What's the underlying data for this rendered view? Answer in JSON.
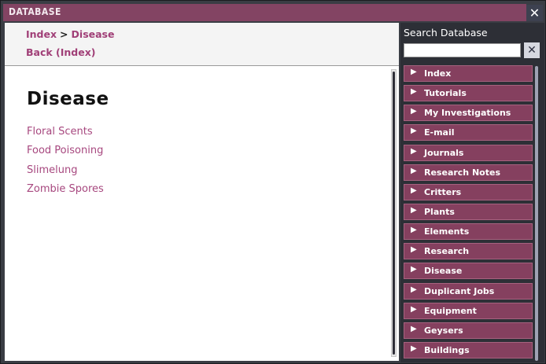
{
  "window": {
    "title": "DATABASE",
    "close_icon": "close-icon"
  },
  "breadcrumb": {
    "items": [
      "Index",
      "Disease"
    ],
    "separator": ">"
  },
  "back_link": "Back (Index)",
  "page": {
    "title": "Disease",
    "entries": [
      "Floral Scents",
      "Food Poisoning",
      "Slimelung",
      "Zombie Spores"
    ]
  },
  "search": {
    "label": "Search Database",
    "value": "",
    "placeholder": "",
    "clear_icon": "close-icon"
  },
  "categories": [
    {
      "label": "Index"
    },
    {
      "label": "Tutorials"
    },
    {
      "label": "My Investigations"
    },
    {
      "label": "E-mail"
    },
    {
      "label": "Journals"
    },
    {
      "label": "Research Notes"
    },
    {
      "label": "Critters"
    },
    {
      "label": "Plants"
    },
    {
      "label": "Elements"
    },
    {
      "label": "Research"
    },
    {
      "label": "Disease"
    },
    {
      "label": "Duplicant Jobs"
    },
    {
      "label": "Equipment"
    },
    {
      "label": "Geysers"
    },
    {
      "label": "Buildings"
    }
  ],
  "colors": {
    "accent": "#834463",
    "link": "#a03f77",
    "panel_dark": "#2d2f36"
  }
}
